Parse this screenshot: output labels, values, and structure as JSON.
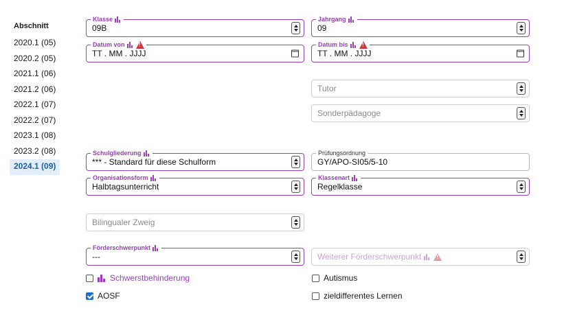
{
  "sidebar": {
    "heading": "Abschnitt",
    "items": [
      {
        "label": "2020.1 (05)"
      },
      {
        "label": "2020.2 (05)"
      },
      {
        "label": "2021.1 (06)"
      },
      {
        "label": "2021.2 (06)"
      },
      {
        "label": "2022.1 (07)"
      },
      {
        "label": "2022.2 (07)"
      },
      {
        "label": "2023.1 (08)"
      },
      {
        "label": "2023.2 (08)"
      },
      {
        "label": "2024.1 (09)"
      }
    ],
    "selected": "2024.1 (09)"
  },
  "form": {
    "klasse": {
      "label": "Klasse",
      "value": "09B"
    },
    "jahrgang": {
      "label": "Jahrgang",
      "value": "09"
    },
    "datum_von": {
      "label": "Datum von",
      "value": "TT . MM . JJJJ"
    },
    "datum_bis": {
      "label": "Datum bis",
      "value": "TT . MM . JJJJ"
    },
    "tutor": {
      "placeholder": "Tutor"
    },
    "sonderpaedagoge": {
      "placeholder": "Sonderpädagoge"
    },
    "schulgliederung": {
      "label": "Schulgliederung",
      "value": "*** - Standard für diese Schulform"
    },
    "pruefungsordnung": {
      "label": "Prüfungsordnung",
      "value": "GY/APO-SI05/5-10"
    },
    "organisationsform": {
      "label": "Organisationsform",
      "value": "Halbtagsunterricht"
    },
    "klassenart": {
      "label": "Klassenart",
      "value": "Regelklasse"
    },
    "bilingualer_zweig": {
      "placeholder": "Bilingualer Zweig"
    },
    "foerderschwerpunkt": {
      "label": "Förderschwerpunkt",
      "value": "---"
    },
    "weiterer_foerderschwerpunkt": {
      "placeholder": "Weiterer Förderschwerpunkt"
    }
  },
  "checkboxes": {
    "schwerstbehinderung": {
      "label": "Schwerstbehinderung",
      "checked": false
    },
    "aosf": {
      "label": "AOSF",
      "checked": true
    },
    "autismus": {
      "label": "Autismus",
      "checked": false
    },
    "zieldifferentes_lernen": {
      "label": "zieldifferentes Lernen",
      "checked": false
    }
  },
  "colors": {
    "accent": "#9a3fb5",
    "selected_bg": "#e3eefb",
    "selected_text": "#1b5fa8",
    "warning": "#d1343e",
    "checkbox_checked": "#1e6fcf"
  },
  "icons": {
    "stats": "bar-chart-icon",
    "warning": "warning-icon",
    "calendar": "calendar-icon",
    "spinner": "spinner-arrows-icon"
  }
}
